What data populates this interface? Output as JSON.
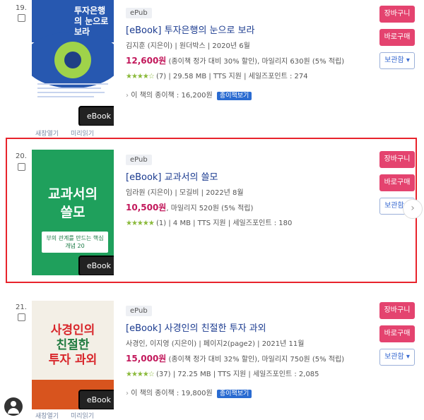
{
  "items": [
    {
      "number": "19.",
      "format": "ePub",
      "title": "[eBook] 투자은행의 눈으로 보라",
      "meta": "김지훈 (지은이) | 원더박스 | 2020년 6월",
      "price": "12,600원",
      "price_rest": " (종이책 정가 대비 30% 할인), 마일리지 630원 (5% 적립)",
      "rating_stars": "★★★★☆",
      "details": " (7) | 29.58 MB | TTS 지원 | 세일즈포인트 : 274",
      "paper_price": "이 책의 종이책 : 16,200원",
      "paper_btn": "종이책보기",
      "cover_title": "투자은행의 눈으로 보라",
      "ebook_tag": "eBook",
      "below_links": [
        "새창열기",
        "미리읽기"
      ]
    },
    {
      "number": "20.",
      "format": "ePub",
      "title": "[eBook] 교과서의 쓸모",
      "meta": "임라원 (지은이) | 모길비 | 2022년 8월",
      "price": "10,500원",
      "price_rest": ", 마일리지 520원 (5% 적립)",
      "rating_stars": "★★★★★",
      "details": " (1) | 4 MB | TTS 지원 | 세일즈포인트 : 180",
      "cover_title_1": "교과서의",
      "cover_title_2": "쓸모",
      "cover_sub": "부의 관계를 만드는 핵심 개념 20",
      "ebook_tag": "eBook"
    },
    {
      "number": "21.",
      "format": "ePub",
      "title": "[eBook] 사경인의 친절한 투자 과외",
      "meta": "사경인, 이지영 (지은이) | 페이지2(page2) | 2021년 11월",
      "price": "15,000원",
      "price_rest": " (종이책 정가 대비 32% 할인), 마일리지 750원 (5% 적립)",
      "rating_stars": "★★★★☆",
      "details": " (37) | 72.25 MB | TTS 지원 | 세일즈포인트 : 2,085",
      "paper_price": "이 책의 종이책 : 19,800원",
      "paper_btn": "종이책보기",
      "cover_title_1": "사경인의",
      "cover_title_2": "친절한",
      "cover_title_3": "투자 과외",
      "ebook_tag": "eBook",
      "below_links": [
        "새창열기",
        "미리읽기"
      ]
    }
  ],
  "buttons": {
    "cart": "장바구니",
    "buy": "바로구매",
    "keep": "보관함 ▾"
  }
}
